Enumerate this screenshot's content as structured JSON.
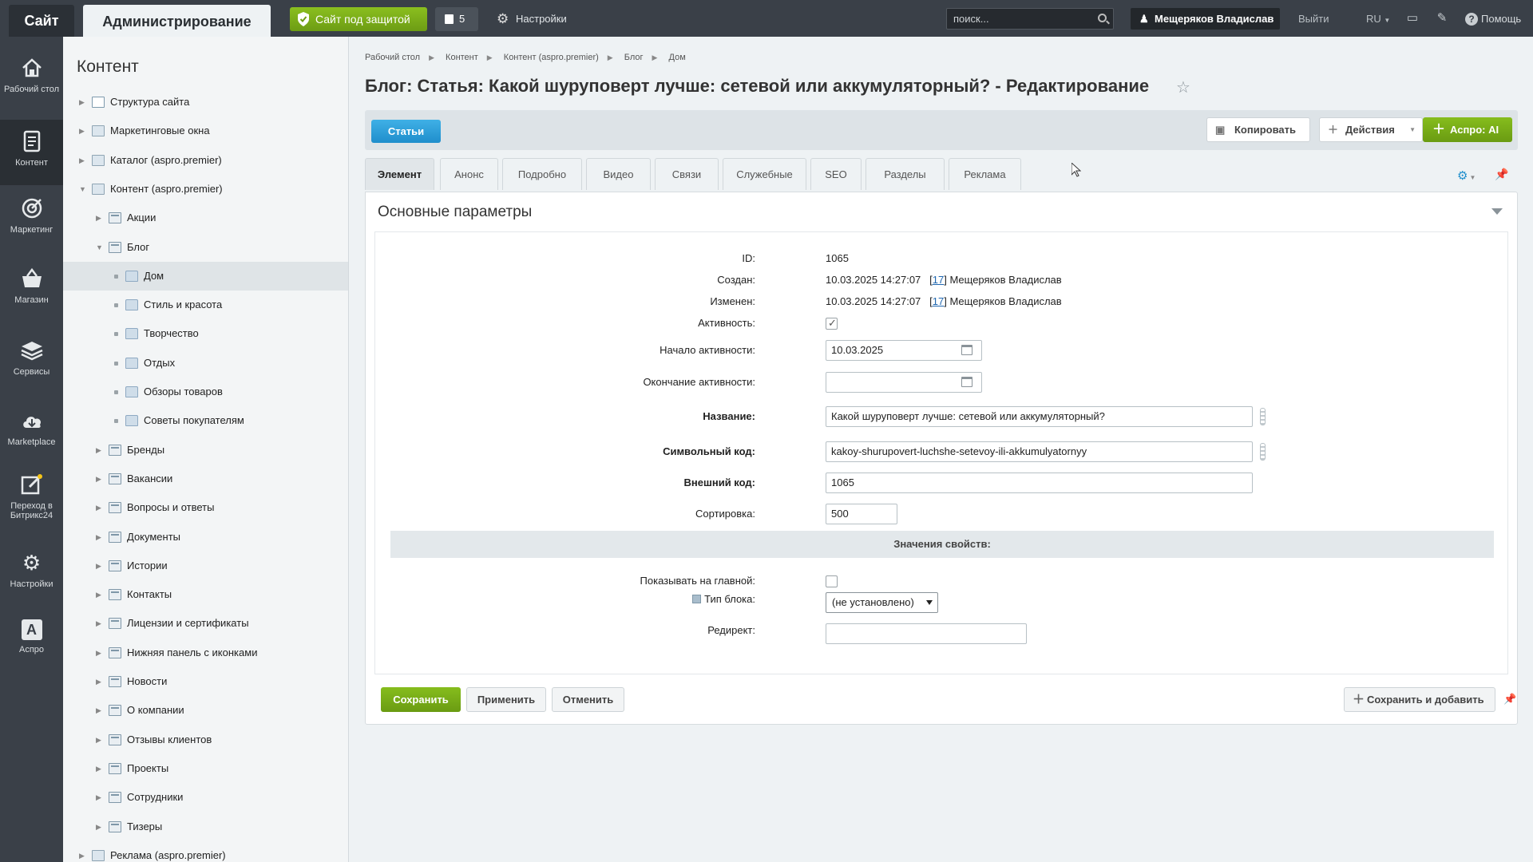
{
  "topbar": {
    "site_tab": "Сайт",
    "admin_tab": "Администрирование",
    "protected_label": "Сайт под защитой",
    "notes_count": "5",
    "settings_label": "Настройки",
    "search_placeholder": "поиск...",
    "user_name": "Мещеряков Владислав",
    "logout": "Выйти",
    "lang": "RU",
    "help": "Помощь"
  },
  "rail": [
    {
      "label": "Рабочий стол",
      "icon": "home-icon"
    },
    {
      "label": "Контент",
      "icon": "document-icon",
      "active": true
    },
    {
      "label": "Маркетинг",
      "icon": "target-icon"
    },
    {
      "label": "Магазин",
      "icon": "basket-icon"
    },
    {
      "label": "Сервисы",
      "icon": "layers-icon"
    },
    {
      "label": "Marketplace",
      "icon": "cloud-icon"
    },
    {
      "label": "Переход в Битрикс24",
      "icon": "edit-icon"
    },
    {
      "label": "Настройки",
      "icon": "gear-icon"
    },
    {
      "label": "Аспро",
      "icon": "aspro-icon"
    }
  ],
  "tree": {
    "title": "Контент",
    "items": [
      {
        "label": "Структура сайта",
        "level": 0,
        "arrow": "right"
      },
      {
        "label": "Маркетинговые окна",
        "level": 0,
        "arrow": "right"
      },
      {
        "label": "Каталог (aspro.premier)",
        "level": 0,
        "arrow": "right"
      },
      {
        "label": "Контент (aspro.premier)",
        "level": 0,
        "arrow": "down"
      },
      {
        "label": "Акции",
        "level": 1,
        "arrow": "right"
      },
      {
        "label": "Блог",
        "level": 1,
        "arrow": "down"
      },
      {
        "label": "Дом",
        "level": 2,
        "selected": true
      },
      {
        "label": "Стиль и красота",
        "level": 2
      },
      {
        "label": "Творчество",
        "level": 2
      },
      {
        "label": "Отдых",
        "level": 2
      },
      {
        "label": "Обзоры товаров",
        "level": 2
      },
      {
        "label": "Советы покупателям",
        "level": 2
      },
      {
        "label": "Бренды",
        "level": 1,
        "arrow": "right"
      },
      {
        "label": "Вакансии",
        "level": 1,
        "arrow": "right"
      },
      {
        "label": "Вопросы и ответы",
        "level": 1,
        "arrow": "right"
      },
      {
        "label": "Документы",
        "level": 1,
        "arrow": "right"
      },
      {
        "label": "Истории",
        "level": 1,
        "arrow": "right"
      },
      {
        "label": "Контакты",
        "level": 1,
        "arrow": "right"
      },
      {
        "label": "Лицензии и сертификаты",
        "level": 1,
        "arrow": "right"
      },
      {
        "label": "Нижняя панель с иконками",
        "level": 1,
        "arrow": "right"
      },
      {
        "label": "Новости",
        "level": 1,
        "arrow": "right"
      },
      {
        "label": "О компании",
        "level": 1,
        "arrow": "right"
      },
      {
        "label": "Отзывы клиентов",
        "level": 1,
        "arrow": "right"
      },
      {
        "label": "Проекты",
        "level": 1,
        "arrow": "right"
      },
      {
        "label": "Сотрудники",
        "level": 1,
        "arrow": "right"
      },
      {
        "label": "Тизеры",
        "level": 1,
        "arrow": "right"
      },
      {
        "label": "Реклама (aspro.premier)",
        "level": 0,
        "arrow": "right"
      }
    ]
  },
  "breadcrumbs": [
    "Рабочий стол",
    "Контент",
    "Контент (aspro.premier)",
    "Блог",
    "Дом"
  ],
  "page_title": "Блог: Статья: Какой шуруповерт лучше: сетевой или аккумуляторный? - Редактирование",
  "toolbar": {
    "articles": "Статьи",
    "copy": "Копировать",
    "actions": "Действия",
    "aspro_ai": "Аспро: AI"
  },
  "tabs": [
    "Элемент",
    "Анонс",
    "Подробно",
    "Видео",
    "Связи",
    "Служебные",
    "SEO",
    "Разделы",
    "Реклама"
  ],
  "form": {
    "section_title": "Основные параметры",
    "id_label": "ID:",
    "id_value": "1065",
    "created_label": "Создан:",
    "created_date": "10.03.2025 14:27:07",
    "created_user_id": "17",
    "created_user": "Мещеряков Владислав",
    "modified_label": "Изменен:",
    "modified_date": "10.03.2025 14:27:07",
    "modified_user_id": "17",
    "modified_user": "Мещеряков Владислав",
    "active_label": "Активность:",
    "active": true,
    "active_from_label": "Начало активности:",
    "active_from": "10.03.2025",
    "active_to_label": "Окончание активности:",
    "active_to": "",
    "name_label": "Название:",
    "name": "Какой шуруповерт лучше: сетевой или аккумуляторный?",
    "code_label": "Символьный код:",
    "code": "kakoy-shurupovert-luchshe-setevoy-ili-akkumulyatornyy",
    "xml_id_label": "Внешний код:",
    "xml_id": "1065",
    "sort_label": "Сортировка:",
    "sort": "500",
    "props_title": "Значения свойств:",
    "show_main_label": "Показывать на главной:",
    "show_main": false,
    "block_type_label": "Тип блока:",
    "block_type": "(не установлено)",
    "redirect_label": "Редирект:",
    "redirect": ""
  },
  "footer": {
    "save": "Сохранить",
    "apply": "Применить",
    "cancel": "Отменить",
    "save_add": "Сохранить и добавить"
  },
  "colors": {
    "topbar_bg": "#3a4048",
    "green_button": "#7aad18",
    "blue_button": "#2a9ad8",
    "page_bg": "#eef2f4"
  }
}
